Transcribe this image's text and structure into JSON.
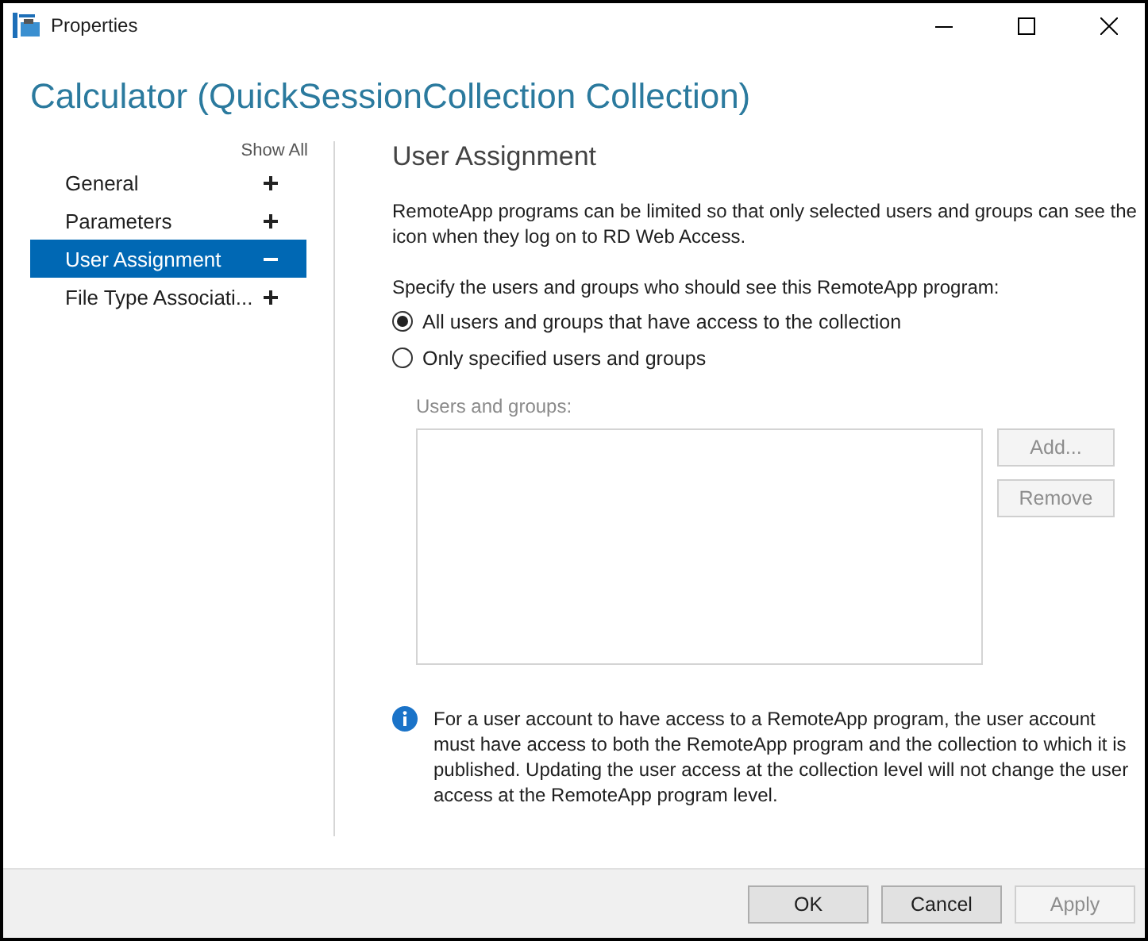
{
  "window": {
    "title": "Properties"
  },
  "header": {
    "title": "Calculator (QuickSessionCollection Collection)"
  },
  "sidebar": {
    "show_all": "Show All",
    "items": [
      {
        "label": "General",
        "selected": false,
        "expanded": false
      },
      {
        "label": "Parameters",
        "selected": false,
        "expanded": false
      },
      {
        "label": "User Assignment",
        "selected": true,
        "expanded": true
      },
      {
        "label": "File Type Associati...",
        "selected": false,
        "expanded": false
      }
    ]
  },
  "content": {
    "heading": "User Assignment",
    "description": "RemoteApp programs can be limited so that only selected users and groups can see the icon when they log on to RD Web Access.",
    "prompt": "Specify the users and groups who should see this RemoteApp program:",
    "options": [
      {
        "label": "All users and groups that have access to the collection",
        "selected": true
      },
      {
        "label": "Only specified users and groups",
        "selected": false
      }
    ],
    "users_label": "Users and groups:",
    "users_disabled": true,
    "buttons": [
      {
        "label": "Add...",
        "disabled": true
      },
      {
        "label": "Remove",
        "disabled": true
      }
    ],
    "info": "For a user account to have access to a RemoteApp program, the user account must have access to both the RemoteApp program and the collection to which it is published. Updating the user access at the collection level will not change the user access at the RemoteApp program level."
  },
  "footer": {
    "buttons": [
      {
        "label": "OK",
        "disabled": false
      },
      {
        "label": "Cancel",
        "disabled": false
      },
      {
        "label": "Apply",
        "disabled": true
      }
    ]
  }
}
